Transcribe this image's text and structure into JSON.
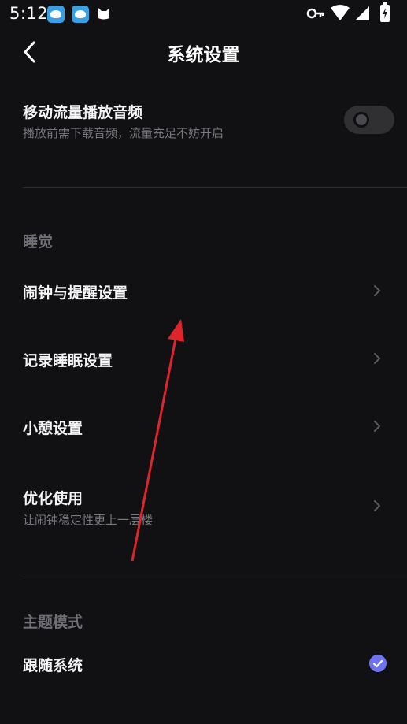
{
  "status_bar": {
    "time": "5:12",
    "icons": [
      "app-icon-1",
      "app-icon-2",
      "cat-icon",
      "key-icon",
      "wifi-icon",
      "signal-icon",
      "battery-charging-icon"
    ]
  },
  "header": {
    "title": "系统设置",
    "back_icon": "chevron-left-icon"
  },
  "settings": {
    "mobile_data": {
      "title": "移动流量播放音频",
      "subtitle": "播放前需下载音频，流量充足不妨开启",
      "enabled": false
    },
    "sleep_section": {
      "header": "睡觉",
      "items": [
        {
          "title": "闹钟与提醒设置",
          "subtitle": ""
        },
        {
          "title": "记录睡眠设置",
          "subtitle": ""
        },
        {
          "title": "小憩设置",
          "subtitle": ""
        },
        {
          "title": "优化使用",
          "subtitle": "让闹钟稳定性更上一层楼"
        }
      ]
    },
    "theme_section": {
      "header": "主题模式",
      "items": [
        {
          "title": "跟随系统",
          "selected": true
        }
      ]
    }
  },
  "colors": {
    "background": "#111113",
    "accent": "#6e74f0",
    "annotation_arrow": "#e0242c",
    "secondary_text": "#77777d"
  }
}
